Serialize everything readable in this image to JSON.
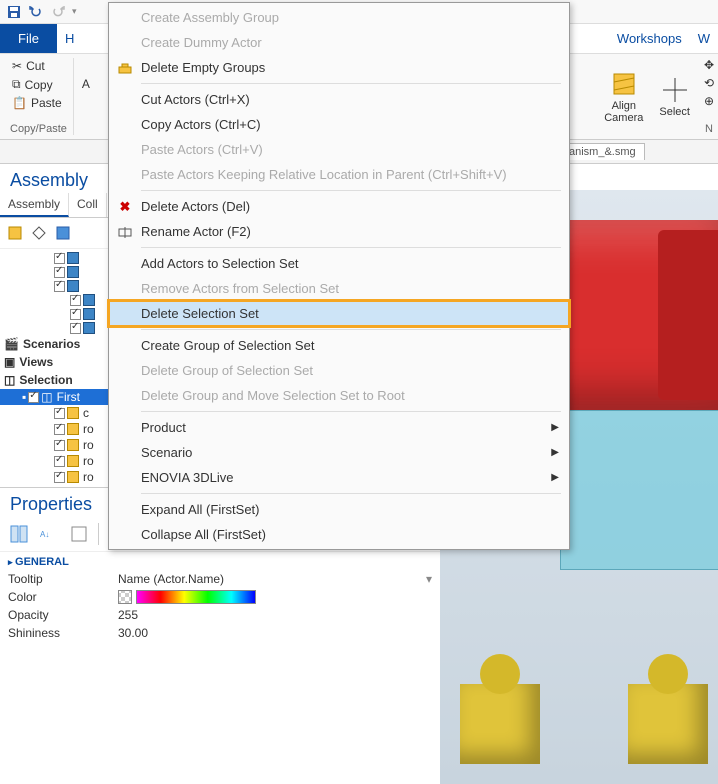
{
  "qat": {
    "dropdown": "▾"
  },
  "ribbon": {
    "file": "File",
    "home_partial": "H",
    "workshops": "Workshops",
    "w_partial": "W"
  },
  "clipboard": {
    "cut": "Cut",
    "copy": "Copy",
    "paste": "Paste",
    "group_label": "Copy/Paste",
    "a_partial": "A"
  },
  "ribbon_right": {
    "align_camera": "Align\nCamera",
    "select": "Select",
    "n_partial": "N"
  },
  "doc_tab": "anism_&.smg",
  "assembly": {
    "title": "Assembly",
    "tab_assembly": "Assembly",
    "tab_coll": "Coll",
    "scenarios": "Scenarios",
    "views": "Views",
    "selection": "Selection",
    "first": "First",
    "items": [
      {
        "label": "c"
      },
      {
        "label": "ro"
      },
      {
        "label": "ro"
      },
      {
        "label": "ro"
      },
      {
        "label": "ro"
      }
    ]
  },
  "properties": {
    "title": "Properties",
    "section": "GENERAL",
    "rows": {
      "tooltip": {
        "label": "Tooltip",
        "value": "Name (Actor.Name)"
      },
      "color": {
        "label": "Color"
      },
      "opacity": {
        "label": "Opacity",
        "value": "255"
      },
      "shininess": {
        "label": "Shininess",
        "value": "30.00"
      }
    }
  },
  "context_menu": {
    "items": [
      {
        "label": "Create Assembly Group",
        "enabled": false
      },
      {
        "label": "Create Dummy Actor",
        "enabled": false
      },
      {
        "label": "Delete Empty Groups",
        "enabled": true,
        "icon": "group"
      },
      {
        "sep": true
      },
      {
        "label": "Cut Actors (Ctrl+X)",
        "enabled": true
      },
      {
        "label": "Copy Actors (Ctrl+C)",
        "enabled": true
      },
      {
        "label": "Paste Actors (Ctrl+V)",
        "enabled": false
      },
      {
        "label": "Paste Actors Keeping Relative Location in Parent (Ctrl+Shift+V)",
        "enabled": false
      },
      {
        "sep": true
      },
      {
        "label": "Delete Actors (Del)",
        "enabled": true,
        "icon": "x-red"
      },
      {
        "label": "Rename Actor (F2)",
        "enabled": true,
        "icon": "rename"
      },
      {
        "sep": true
      },
      {
        "label": "Add Actors to Selection Set",
        "enabled": true
      },
      {
        "label": "Remove Actors from Selection Set",
        "enabled": false
      },
      {
        "label": "Delete Selection Set",
        "enabled": true,
        "highlight": true
      },
      {
        "sep": true
      },
      {
        "label": "Create Group of Selection Set",
        "enabled": true
      },
      {
        "label": "Delete Group of Selection Set",
        "enabled": false
      },
      {
        "label": "Delete Group and Move Selection Set to Root",
        "enabled": false
      },
      {
        "sep": true
      },
      {
        "label": "Product",
        "enabled": true,
        "submenu": true
      },
      {
        "label": "Scenario",
        "enabled": true,
        "submenu": true
      },
      {
        "label": "ENOVIA 3DLive",
        "enabled": true,
        "submenu": true
      },
      {
        "sep": true
      },
      {
        "label": "Expand All (FirstSet)",
        "enabled": true
      },
      {
        "label": "Collapse All (FirstSet)",
        "enabled": true
      }
    ]
  }
}
